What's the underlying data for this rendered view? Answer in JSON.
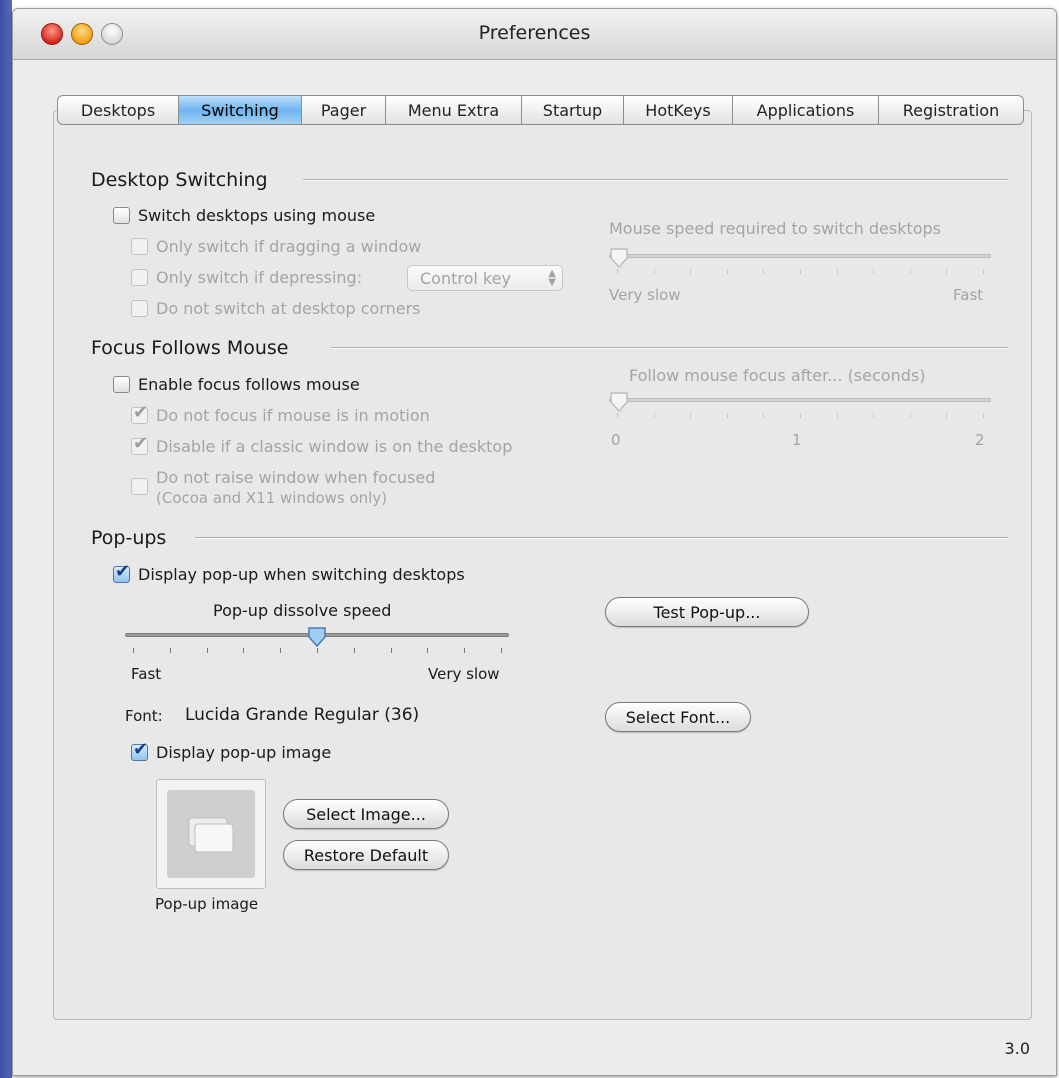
{
  "window": {
    "title": "Preferences",
    "version": "3.0"
  },
  "tabs": [
    {
      "label": "Desktops",
      "selected": false
    },
    {
      "label": "Switching",
      "selected": true
    },
    {
      "label": "Pager",
      "selected": false
    },
    {
      "label": "Menu Extra",
      "selected": false
    },
    {
      "label": "Startup",
      "selected": false
    },
    {
      "label": "HotKeys",
      "selected": false
    },
    {
      "label": "Applications",
      "selected": false
    },
    {
      "label": "Registration",
      "selected": false
    }
  ],
  "desktop_switching": {
    "title": "Desktop Switching",
    "switch_using_mouse": {
      "label": "Switch desktops using mouse",
      "checked": false
    },
    "only_if_dragging": {
      "label": "Only switch if dragging a window",
      "checked": false,
      "enabled": false
    },
    "only_if_depressing": {
      "label": "Only switch if depressing:",
      "checked": false,
      "enabled": false
    },
    "depress_key": {
      "value": "Control key"
    },
    "no_corners": {
      "label": "Do not switch at desktop corners",
      "checked": false,
      "enabled": false
    },
    "speed_slider": {
      "label": "Mouse speed required to switch desktops",
      "min_label": "Very slow",
      "max_label": "Fast",
      "position": 0.0,
      "enabled": false
    }
  },
  "focus_follows_mouse": {
    "title": "Focus Follows Mouse",
    "enable": {
      "label": "Enable focus follows mouse",
      "checked": false
    },
    "no_focus_motion": {
      "label": "Do not focus if mouse is in motion",
      "checked": true,
      "enabled": false
    },
    "disable_classic": {
      "label": "Disable if a classic window is on the desktop",
      "checked": true,
      "enabled": false
    },
    "no_raise": {
      "label_line1": "Do not raise window when focused",
      "label_line2": "(Cocoa and X11 windows only)",
      "checked": false,
      "enabled": false
    },
    "delay_slider": {
      "label": "Follow mouse focus after... (seconds)",
      "tick_labels": [
        "0",
        "1",
        "2"
      ],
      "position": 0.0,
      "enabled": false
    }
  },
  "popups": {
    "title": "Pop-ups",
    "display_popup": {
      "label": "Display pop-up when switching desktops",
      "checked": true
    },
    "dissolve_slider": {
      "label": "Pop-up dissolve speed",
      "min_label": "Fast",
      "max_label": "Very slow",
      "position": 0.5
    },
    "test_button": "Test Pop-up...",
    "font_label": "Font:",
    "font_value": "Lucida Grande Regular (36)",
    "select_font_button": "Select Font...",
    "display_image": {
      "label": "Display pop-up image",
      "checked": true
    },
    "select_image_button": "Select Image...",
    "restore_default_button": "Restore Default",
    "image_caption": "Pop-up image"
  }
}
